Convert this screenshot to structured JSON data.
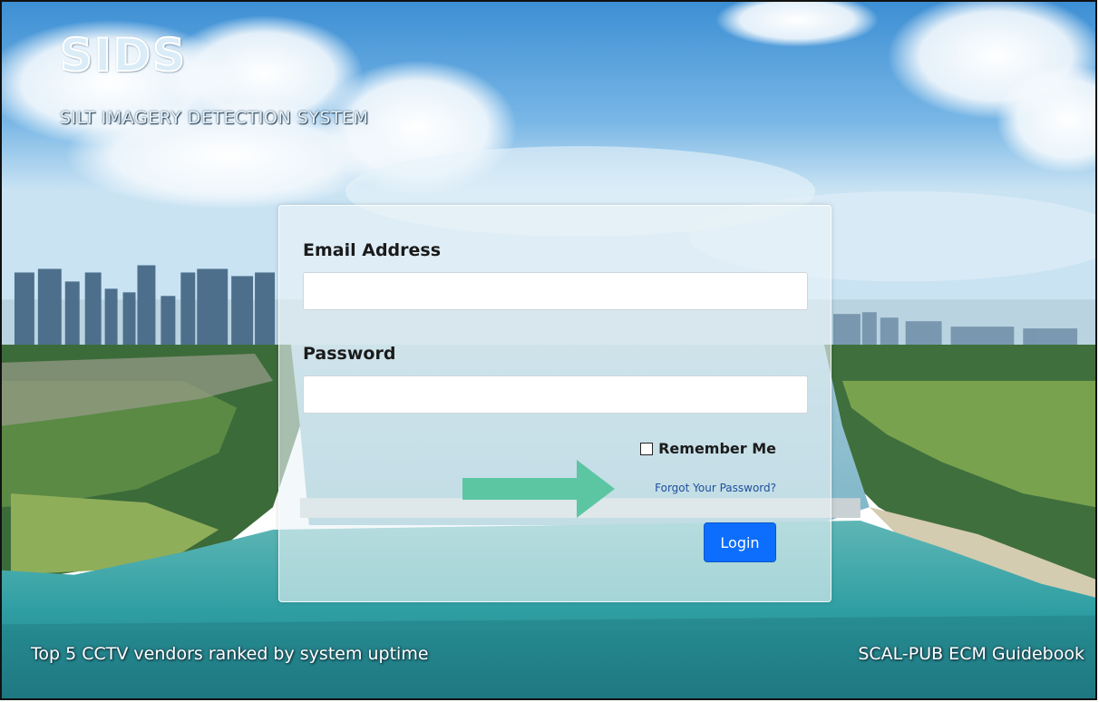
{
  "brand": {
    "title": "SIDS",
    "subtitle": "SILT IMAGERY DETECTION SYSTEM"
  },
  "login": {
    "email_label": "Email Address",
    "email_value": "",
    "password_label": "Password",
    "password_value": "",
    "remember_label": "Remember Me",
    "remember_checked": false,
    "forgot_label": "Forgot Your Password?",
    "login_label": "Login"
  },
  "annotation": {
    "arrow_color": "#5cc6a3",
    "arrow_icon": "arrow-right-icon"
  },
  "footer": {
    "left_link": "Top 5 CCTV vendors ranked by system uptime",
    "right_link": "SCAL-PUB ECM Guidebook"
  },
  "colors": {
    "primary_button": "#0d6efd",
    "link": "#1d4f9c"
  }
}
